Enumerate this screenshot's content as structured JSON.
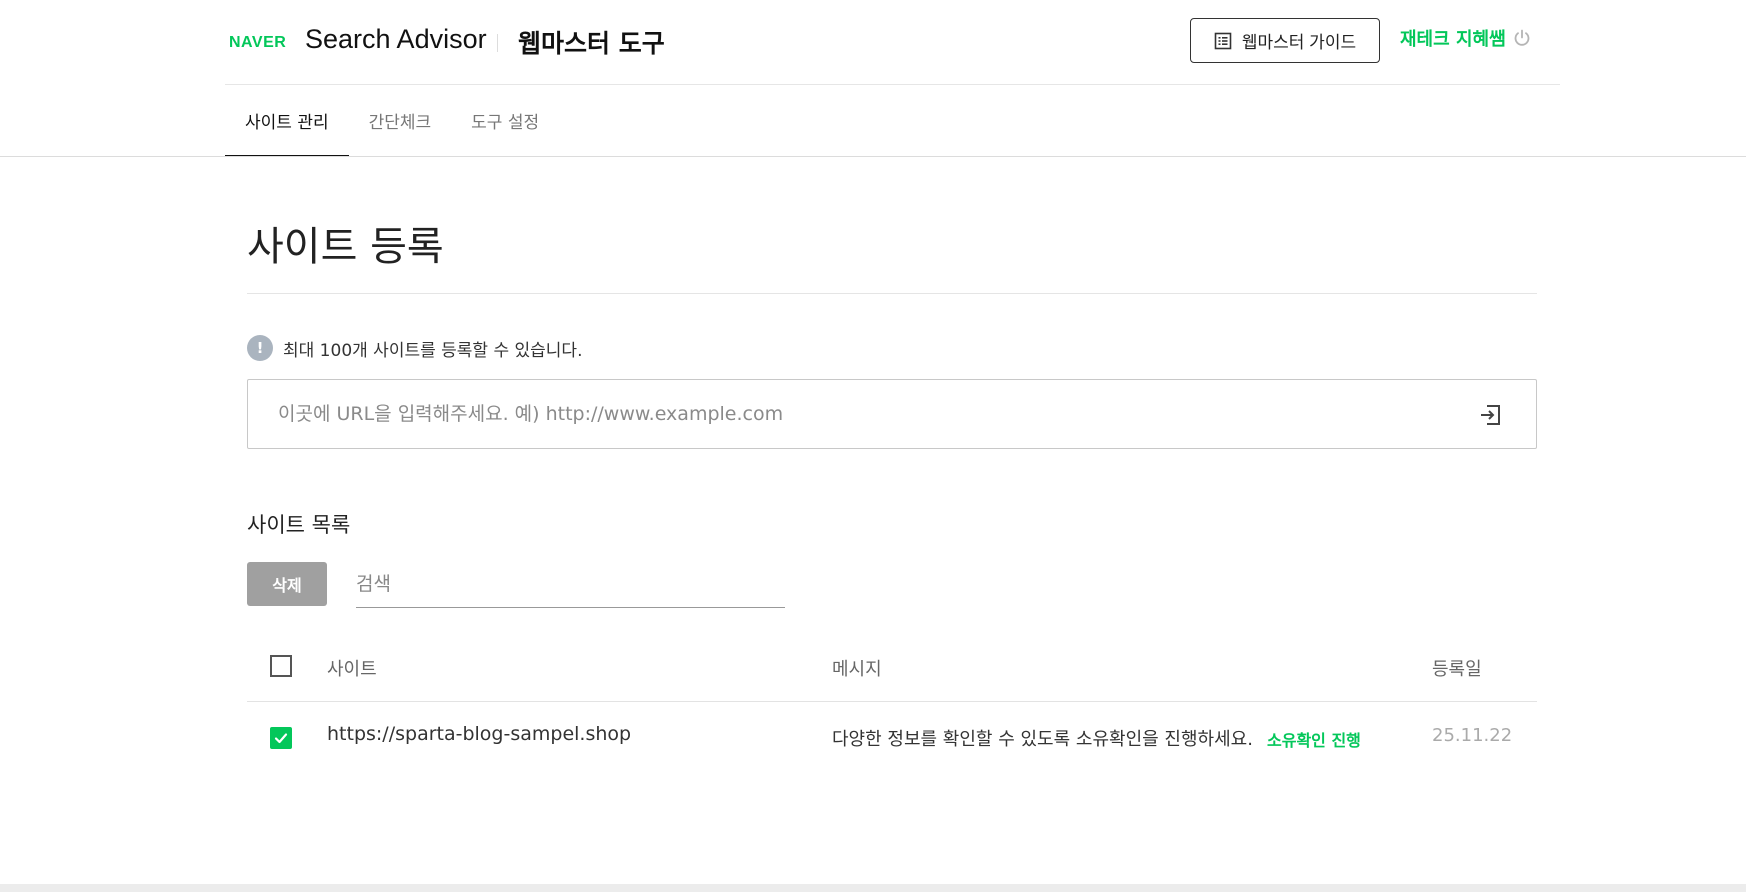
{
  "header": {
    "logo_brand": "NAVER",
    "logo_title": "Search Advisor",
    "logo_sub": "웹마스터 도구",
    "guide_button_label": "웹마스터 가이드",
    "user_name": "재테크 지혜쌤"
  },
  "tabs": [
    {
      "label": "사이트 관리",
      "active": true
    },
    {
      "label": "간단체크",
      "active": false
    },
    {
      "label": "도구 설정",
      "active": false
    }
  ],
  "main": {
    "page_title": "사이트 등록",
    "notice": "최대 100개 사이트를 등록할 수 있습니다.",
    "url_placeholder": "이곳에 URL을 입력해주세요. 예) http://www.example.com",
    "list_title": "사이트 목록",
    "delete_label": "삭제",
    "search_placeholder": "검색"
  },
  "table": {
    "columns": {
      "site": "사이트",
      "message": "메시지",
      "date": "등록일"
    },
    "rows": [
      {
        "site": "https://sparta-blog-sampel.shop",
        "message": "다양한 정보를 확인할 수 있도록 소유확인을 진행하세요.",
        "action": "소유확인 진행",
        "date": "25.11.22",
        "checked": true
      }
    ]
  },
  "colors": {
    "brand_green": "#03c75a",
    "delete_button_gray": "#a0a0a0"
  },
  "icons": {
    "notice": "exclamation-circle-icon",
    "guide": "list-document-icon",
    "logout": "power-icon",
    "submit": "enter-arrow-icon",
    "check": "check-icon"
  }
}
